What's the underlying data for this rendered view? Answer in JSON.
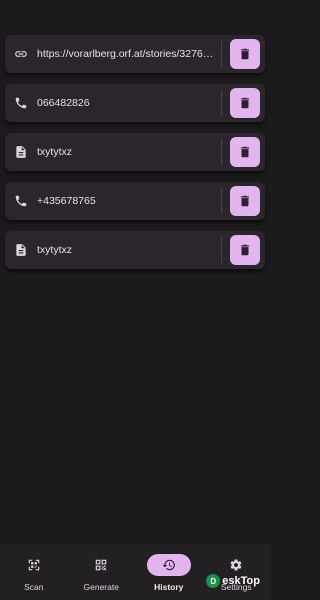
{
  "history": [
    {
      "type_icon": "link-icon",
      "text": "https://vorarlberg.orf.at/stories/327663..."
    },
    {
      "type_icon": "phone-icon",
      "text": "066482826"
    },
    {
      "type_icon": "text-document-icon",
      "text": "txytytxz"
    },
    {
      "type_icon": "phone-icon",
      "text": "+435678765"
    },
    {
      "type_icon": "text-document-icon",
      "text": "txytytxz"
    }
  ],
  "nav": {
    "scan": "Scan",
    "generate": "Generate",
    "history": "History",
    "settings": "Settings"
  },
  "watermark": {
    "text": "eskTop",
    "mark": "D"
  },
  "colors": {
    "background": "#1c1a1d",
    "card": "#2a262b",
    "accent": "#e3b5ee",
    "navbar": "#232024"
  }
}
